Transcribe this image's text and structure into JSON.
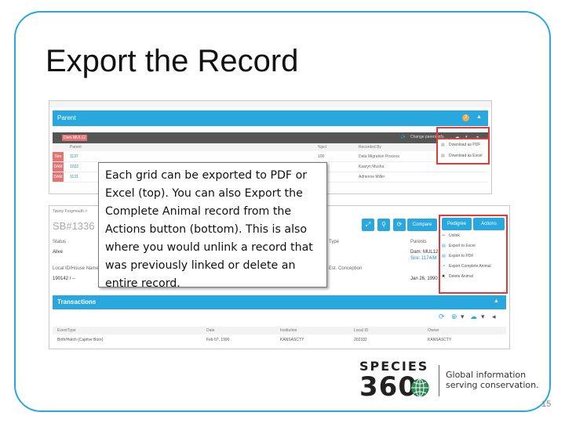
{
  "slide": {
    "title": "Export the Record",
    "page_number": "15",
    "accent_color": "#2aa7df"
  },
  "top_screenshot": {
    "panel_title": "Parent",
    "badge_count": "2",
    "selected_id": "Dam MUL12",
    "change_view_label": "Change parent info",
    "columns": [
      "Parent",
      "%pct",
      "Recorded By"
    ],
    "rows": [
      {
        "tag": "Sire",
        "parent": "1137",
        "pct": "100",
        "recorded_by": "Data Migration Process"
      },
      {
        "tag": "DAM",
        "parent": "1022",
        "pct": "",
        "recorded_by": "Kaaryn Musha"
      },
      {
        "tag": "DAM",
        "parent": "1131",
        "pct": "",
        "recorded_by": "Adrienne Miller"
      }
    ],
    "download_menu": [
      "Download as PDF",
      "Download as Excel"
    ]
  },
  "bottom_screenshot": {
    "animal_name": "Tawny Frogmouth >",
    "record_id": "SB#1336",
    "fields": {
      "status_label": "Status",
      "status_value": "Alive",
      "local_id_label": "Local ID/House Name",
      "local_id_value": "190142 / --",
      "type_label": "Type",
      "parents_label": "Parents",
      "dam_value": "Dam: MUL12",
      "sire_value": "Sire: 1174/M",
      "conception_label": "Est. Conception",
      "conception_value": "Jan 26, 1990"
    },
    "compare_label": "Compare",
    "pedigree_label": "Pedigree",
    "actions_label": "Actions",
    "actions_menu": [
      "Unlink",
      "Export to Excel",
      "Export to PDF",
      "Export Complete Animal",
      "Delete Animal"
    ],
    "transactions_title": "Transactions",
    "tx_columns": [
      "EventType",
      "Date",
      "Institution",
      "Local ID",
      "Owner"
    ],
    "tx_row": {
      "event": "Birth/Hatch (Captive Born)",
      "date": "Feb 07, 1990",
      "institution": "KANSASCTY",
      "local_id": "202332",
      "owner": "KANSASCTY"
    }
  },
  "callout_text": "Each grid can be exported to PDF or Excel (top). You can also Export the Complete Animal record from the Actions button (bottom). This is also where you would unlink a record that was previously linked or delete an entire record.",
  "logo": {
    "species": "SPECIES",
    "number": "360",
    "tagline_line1": "Global information",
    "tagline_line2": "serving conservation."
  }
}
